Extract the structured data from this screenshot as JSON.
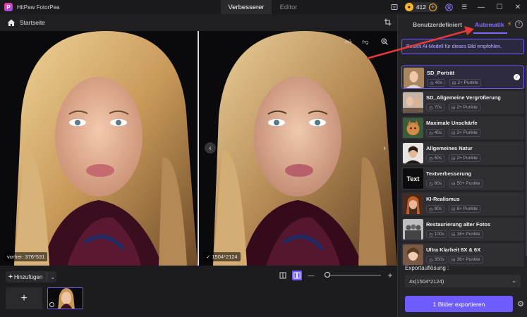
{
  "app": {
    "title": "HitPaw FotorPea",
    "logo_letter": "P",
    "tabs": [
      {
        "label": "Verbesserer",
        "active": true
      },
      {
        "label": "Editor",
        "active": false
      }
    ],
    "coins": "412",
    "accent": "#6f5cff"
  },
  "toolbar": {
    "home_label": "Startseite"
  },
  "preview": {
    "before_label": "vorher: 376*531",
    "after_label": "1504*2124"
  },
  "bottom": {
    "add_label": "Hinzufügen"
  },
  "panel": {
    "tab_custom": "Benutzerdefiniert",
    "tab_auto": "Automatik",
    "recommend_text": "Bestes AI-Modell für dieses Bild empfohlen.",
    "models": [
      {
        "name": "SD_Porträt",
        "time": "40s",
        "points": "2+ Punkte",
        "selected": true
      },
      {
        "name": "SD_Allgemeine Vergrößerung",
        "time": "70s",
        "points": "2+ Punkte",
        "selected": false
      },
      {
        "name": "Maximale Unschärfe",
        "time": "40s",
        "points": "2+ Punkte",
        "selected": false
      },
      {
        "name": "Allgemeines Natur",
        "time": "60s",
        "points": "2+ Punkte",
        "selected": false
      },
      {
        "name": "Textverbesserung",
        "time": "80s",
        "points": "50+ Punkte",
        "selected": false
      },
      {
        "name": "KI-Realismus",
        "time": "80s",
        "points": "8+ Punkte",
        "selected": false
      },
      {
        "name": "Restaurierung alter Fotos",
        "time": "100s",
        "points": "16+ Punkte",
        "selected": false
      },
      {
        "name": "Ultra Klarheit 8X & 6X",
        "time": "350s",
        "points": "36+ Punkte",
        "selected": false
      }
    ],
    "text_thumb": "Text",
    "export_label": "Exportauflösung :",
    "export_value": "4x(1504*2124)",
    "export_button": "1 Bilder exportieren"
  }
}
